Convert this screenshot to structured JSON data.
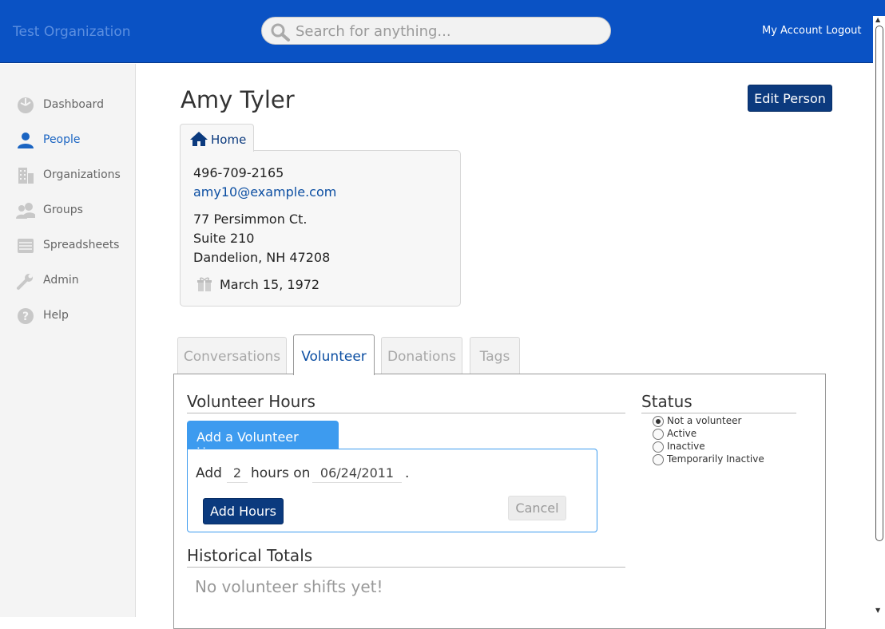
{
  "header": {
    "org_name": "Test Organization",
    "search_placeholder": "Search for anything...",
    "my_account": "My Account",
    "logout": "Logout"
  },
  "sidebar": {
    "items": [
      {
        "label": "Dashboard",
        "icon": "dashboard-icon"
      },
      {
        "label": "People",
        "icon": "person-icon",
        "active": true
      },
      {
        "label": "Organizations",
        "icon": "building-icon"
      },
      {
        "label": "Groups",
        "icon": "group-icon"
      },
      {
        "label": "Spreadsheets",
        "icon": "spreadsheet-icon"
      },
      {
        "label": "Admin",
        "icon": "wrench-icon"
      },
      {
        "label": "Help",
        "icon": "help-icon"
      }
    ]
  },
  "person": {
    "name": "Amy Tyler",
    "edit_label": "Edit Person",
    "home_tab": "Home",
    "phone": "496-709-2165",
    "email": "amy10@example.com",
    "address_line1": "77 Persimmon Ct.",
    "address_line2": "Suite 210",
    "address_line3": "Dandelion, NH 47208",
    "birthday": "March 15, 1972"
  },
  "tabs": [
    {
      "label": "Conversations"
    },
    {
      "label": "Volunteer",
      "active": true
    },
    {
      "label": "Donations"
    },
    {
      "label": "Tags"
    }
  ],
  "volunteer": {
    "hours_title": "Volunteer Hours",
    "add_tab_label": "Add a Volunteer Hours",
    "add_word": "Add",
    "hours_value": "2",
    "hours_on": "hours on",
    "date_value": "06/24/2011",
    "period": ".",
    "add_button": "Add Hours",
    "cancel_button": "Cancel",
    "totals_title": "Historical Totals",
    "empty_message": "No volunteer shifts yet!"
  },
  "status": {
    "title": "Status",
    "selected": "Not a volunteer",
    "options": [
      "Not a volunteer",
      "Active",
      "Inactive",
      "Temporarily Inactive"
    ]
  },
  "colors": {
    "header_bg": "#0a52c4",
    "primary_button": "#0b3a7e",
    "accent_blue": "#3d9bef",
    "link": "#0b4ea2"
  }
}
